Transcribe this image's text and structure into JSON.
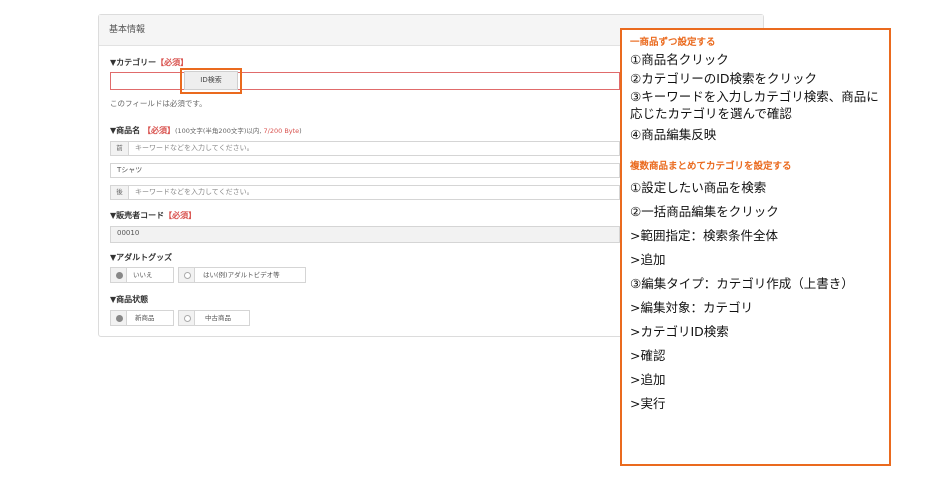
{
  "panel": {
    "header": "基本情報",
    "category": {
      "label": "▼カテゴリー",
      "required": "【必須】",
      "search_button": "ID検索",
      "value": "",
      "validation": "このフィールドは必須です。"
    },
    "product_name": {
      "label": "▼商品名",
      "required": "【必須】",
      "note_prefix": "(100文字(半角200文字)以内, ",
      "count": "7/200 Byte",
      "note_suffix": ")",
      "prefix_addon": "前",
      "prefix_placeholder": "キーワードなどを入力してください。",
      "value": "Tシャツ",
      "suffix_addon": "後",
      "suffix_placeholder": "キーワードなどを入力してください。"
    },
    "seller_code": {
      "label": "▼販売者コード",
      "required": "【必須】",
      "value": "00010"
    },
    "adult_goods": {
      "label": "▼アダルトグッズ",
      "options": [
        "いいえ",
        "はい(例)アダルトビデオ等"
      ],
      "selected": 0
    },
    "condition": {
      "label": "▼商品状態",
      "options": [
        "新商品",
        "中古商品"
      ],
      "selected": 0
    }
  },
  "callout": {
    "section1_title": "一商品ずつ設定する",
    "section1_steps": [
      "①商品名クリック",
      "②カテゴリーのID検索をクリック",
      "③キーワードを入力しカテゴリ検索、商品に応じたカテゴリを選んで確認",
      "④商品編集反映"
    ],
    "section2_title": "複数商品まとめてカテゴリを設定する",
    "section2_steps": [
      "①設定したい商品を検索",
      "②一括商品編集をクリック",
      ">範囲指定：検索条件全体",
      ">追加",
      "③編集タイプ：カテゴリ作成（上書き）",
      ">編集対象：カテゴリ",
      ">カテゴリID検索",
      ">確認",
      ">追加",
      ">実行"
    ]
  },
  "colors": {
    "accent_orange": "#ea6a1e",
    "required_red": "#d9534f"
  }
}
